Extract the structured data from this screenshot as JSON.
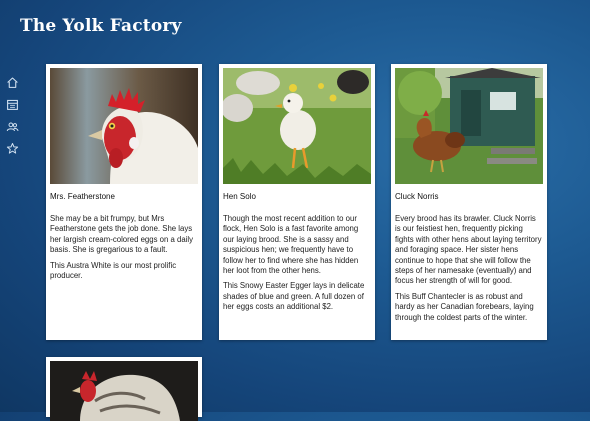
{
  "header": {
    "title": "The Yolk Factory"
  },
  "sidebar": {
    "items": [
      {
        "icon": "home-icon"
      },
      {
        "icon": "calendar-icon"
      },
      {
        "icon": "people-icon"
      },
      {
        "icon": "star-icon"
      }
    ]
  },
  "cards": [
    {
      "name": "Mrs. Featherstone",
      "paragraphs": [
        "She may be a bit frumpy, but Mrs Featherstone gets the job done. She lays her largish cream-colored eggs on a daily basis. She is gregarious to a fault.",
        "This Austra White is our most prolific producer."
      ]
    },
    {
      "name": "Hen Solo",
      "paragraphs": [
        "Though the most recent addition to our flock, Hen Solo is a fast favorite among our laying brood. She is a sassy and suspicious hen; we frequently have to follow her to find where she has hidden her loot from the other hens.",
        "This Snowy Easter Egger lays in delicate shades of blue and green. A full dozen of her eggs costs an additional $2."
      ]
    },
    {
      "name": "Cluck Norris",
      "paragraphs": [
        "Every brood has its brawler. Cluck Norris is our feistiest hen, frequently picking fights with other hens about laying territory and foraging space. Her sister hens continue to hope that she will follow the steps of her namesake (eventually) and focus her strength of will for good.",
        "This Buff Chantecler is as robust and hardy as her Canadian forebears, laying through the coldest parts of the winter."
      ]
    }
  ],
  "colors": {
    "brand_background": "#1d5a92",
    "card": "#ffffff"
  }
}
